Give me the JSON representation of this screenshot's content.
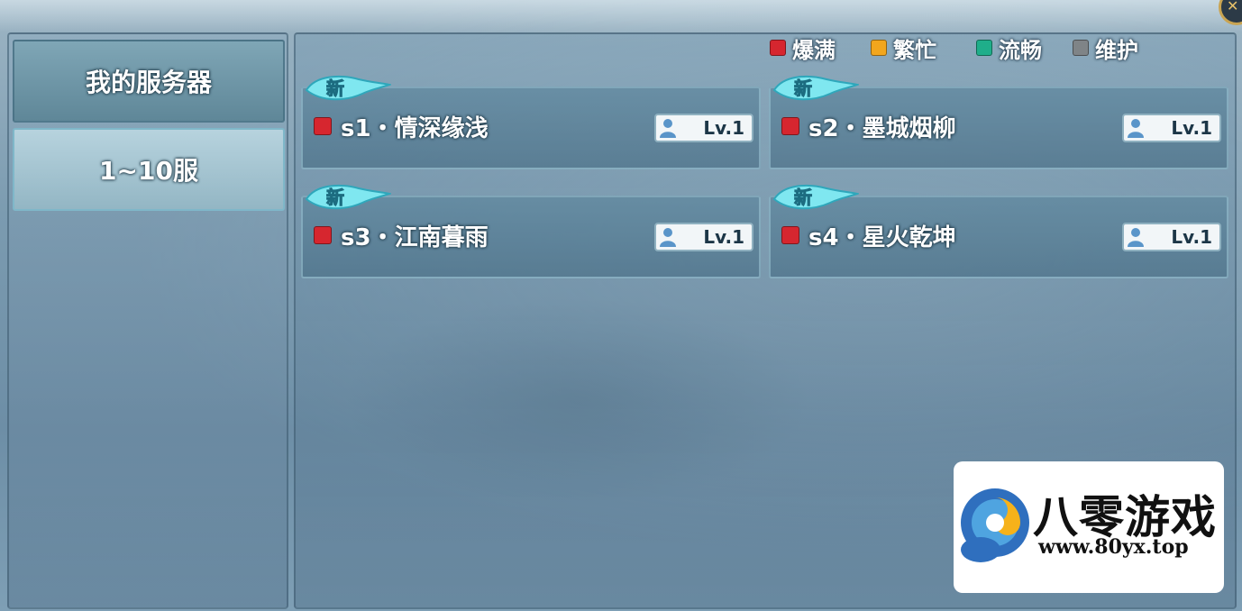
{
  "tabs": [
    {
      "label": "我的服务器"
    },
    {
      "label": "1~10服"
    }
  ],
  "legend": [
    {
      "label": "爆满",
      "color": "#d6262f"
    },
    {
      "label": "繁忙",
      "color": "#f2a61d"
    },
    {
      "label": "流畅",
      "color": "#1fae8a"
    },
    {
      "label": "维护",
      "color": "#7f8487"
    }
  ],
  "servers": [
    {
      "new_tag": "新",
      "name": "s1・情深缘浅",
      "status_color": "#d6262f",
      "level": "Lv.1"
    },
    {
      "new_tag": "新",
      "name": "s2・墨城烟柳",
      "status_color": "#d6262f",
      "level": "Lv.1"
    },
    {
      "new_tag": "新",
      "name": "s3・江南暮雨",
      "status_color": "#d6262f",
      "level": "Lv.1"
    },
    {
      "new_tag": "新",
      "name": "s4・星火乾坤",
      "status_color": "#d6262f",
      "level": "Lv.1"
    }
  ],
  "watermark": {
    "title": "八零游戏",
    "url": "www.80yx.top"
  },
  "icons": [
    "close-icon",
    "status-gem-icon",
    "player-icon",
    "new-banner-icon",
    "logo-icon"
  ]
}
